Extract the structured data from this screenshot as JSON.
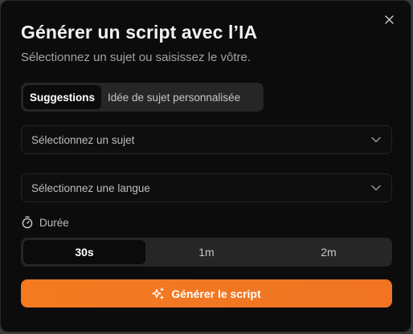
{
  "dialog": {
    "title": "Générer un script avec l’IA",
    "subtitle": "Sélectionnez un sujet ou saisissez le vôtre.",
    "close_icon": "close-icon"
  },
  "tabs": [
    {
      "label": "Suggestions",
      "active": true
    },
    {
      "label": "Idée de sujet personnalisée",
      "active": false
    }
  ],
  "topic_select": {
    "placeholder": "Sélectionnez un sujet",
    "icon": "chevron-down-icon"
  },
  "language_select": {
    "placeholder": "Sélectionnez une langue",
    "icon": "chevron-down-icon"
  },
  "duration": {
    "label": "Durée",
    "icon": "stopwatch-icon",
    "options": [
      {
        "label": "30s",
        "active": true
      },
      {
        "label": "1m",
        "active": false
      },
      {
        "label": "2m",
        "active": false
      }
    ]
  },
  "generate_button": {
    "label": "Générer le script",
    "icon": "sparkles-icon"
  },
  "colors": {
    "background": "#0c0c0c",
    "accent": "#f37a20",
    "segment_bg": "#262626"
  }
}
